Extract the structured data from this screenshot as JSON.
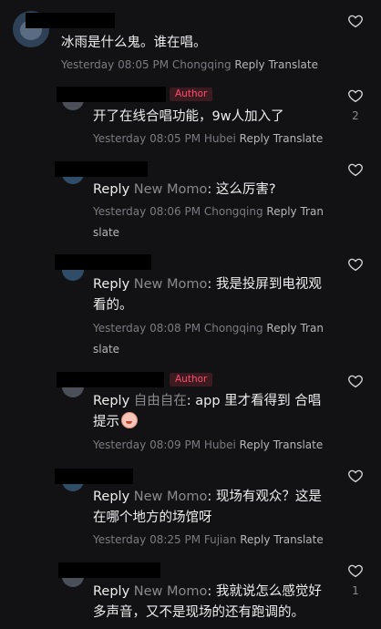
{
  "comments": [
    {
      "text": "冰雨是什么鬼。谁在唱。",
      "meta": "Yesterday 08:05 PM Chongqing",
      "reply": "Reply",
      "translate": "Translate",
      "likes": ""
    },
    {
      "author_tag": "Author",
      "text": "开了在线合唱功能，9w人加入了",
      "meta": "Yesterday 08:05 PM Hubei",
      "reply": "Reply",
      "translate": "Translate",
      "likes": "2"
    },
    {
      "reply_prefix": "Reply",
      "reply_to": "New Momo",
      "text": ": 这么厉害?",
      "meta": "Yesterday 08:06 PM Chongqing",
      "reply": "Reply",
      "translate_a": "Tran",
      "translate_b": "slate",
      "likes": ""
    },
    {
      "reply_prefix": "Reply",
      "reply_to": "New Momo",
      "text": ": 我是投屏到电视观",
      "text2": "看的。",
      "meta": "Yesterday 08:08 PM Chongqing",
      "reply": "Reply",
      "translate_a": "Tran",
      "translate_b": "slate",
      "likes": ""
    },
    {
      "author_tag": "Author",
      "reply_prefix": "Reply",
      "reply_to": "自由自在",
      "text": ": app 里才看得到 合唱",
      "text2": "提示",
      "meta": "Yesterday 08:09 PM Hubei",
      "reply": "Reply",
      "translate": "Translate",
      "likes": ""
    },
    {
      "reply_prefix": "Reply",
      "reply_to": "New Momo",
      "text": ": 现场有观众？这是",
      "text2": "在哪个地方的场馆呀",
      "meta": "Yesterday 08:25 PM Fujian",
      "reply": "Reply",
      "translate": "Translate",
      "likes": ""
    },
    {
      "reply_prefix": "Reply",
      "reply_to": "New Momo",
      "text": ": 我就说怎么感觉好",
      "text2": "多声音，又不是现场的还有跑调的。",
      "likes": "1"
    }
  ],
  "icons": {
    "like": "heart-outline-icon",
    "emoji": "blush-face-emoji-icon"
  },
  "colors": {
    "background": "#121214",
    "author_badge": "#ff4d6d",
    "muted": "#7b7b80"
  }
}
